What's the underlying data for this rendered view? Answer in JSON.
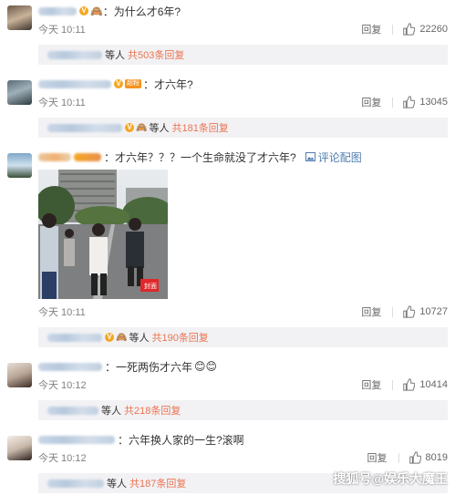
{
  "comments": [
    {
      "text": "：为什么才6年?",
      "time": "今天 10:11",
      "reply": "回复",
      "likes": "22260",
      "sub_mid": "等人",
      "sub_count": "共503条回复"
    },
    {
      "text": "：才六年?",
      "time": "今天 10:11",
      "reply": "回复",
      "likes": "13045",
      "sub_mid": "等人",
      "sub_count": "共181条回复",
      "badge": "超粉"
    },
    {
      "text": "：才六年？？？一个生命就没了才六年?",
      "pic_link": "评论配图",
      "time": "今天 10:11",
      "reply": "回复",
      "likes": "10727",
      "sub_mid": "等人",
      "sub_count": "共190条回复",
      "photo_tag": "封面"
    },
    {
      "text": "：一死两伤才六年",
      "time": "今天 10:12",
      "reply": "回复",
      "likes": "10414",
      "sub_mid": "等人",
      "sub_count": "共218条回复"
    },
    {
      "text": "：六年换人家的一生?滚啊",
      "time": "今天 10:12",
      "reply": "回复",
      "likes": "8019",
      "sub_mid": "等人",
      "sub_count": "共187条回复"
    }
  ],
  "watermark": "搜狐号@娱乐大魔王",
  "colors": {
    "accent": "#eb7350",
    "link_blue": "#507daf",
    "subbar_bg": "#f2f2f5"
  }
}
